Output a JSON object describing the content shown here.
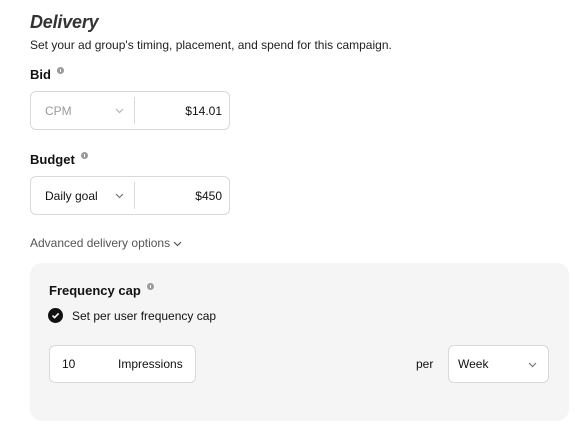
{
  "section": {
    "title": "Delivery",
    "subtitle": "Set your ad group's timing, placement, and spend for this campaign."
  },
  "bid": {
    "label": "Bid",
    "type_value": "CPM",
    "amount": "$14.01"
  },
  "budget": {
    "label": "Budget",
    "type_value": "Daily goal",
    "amount": "$450"
  },
  "advanced": {
    "label": "Advanced delivery options"
  },
  "frequency_cap": {
    "title": "Frequency cap",
    "checkbox_label": "Set per user frequency cap",
    "checked": true,
    "count": "10",
    "unit": "Impressions",
    "per_label": "per",
    "period": "Week"
  },
  "colors": {
    "panel_bg": "#f5f5f5",
    "border": "#d9d9d9",
    "disabled_text": "#9a9a9a"
  },
  "icons": [
    "info-icon",
    "chevron-down-icon",
    "checkmark-icon"
  ]
}
